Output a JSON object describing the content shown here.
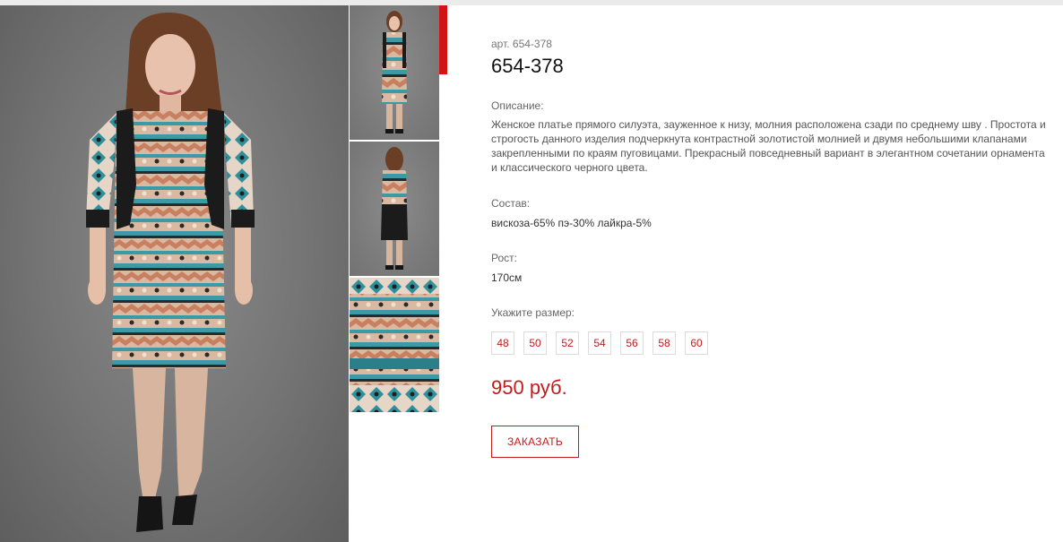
{
  "product": {
    "sku_line": "арт. 654-378",
    "title": "654-378",
    "description_label": "Описание:",
    "description": "Женское платье прямого силуэта, зауженное к низу, молния  расположена сзади  по среднему шву  . Простота и строгость данного изделия подчеркнута контрастной золотистой молнией и  двумя небольшими клапанами закрепленными по краям пуговицами. Прекрасный повседневный  вариант  в элегантном сочетании орнамента и классического черного цвета.",
    "composition_label": "Состав:",
    "composition": "вискоза-65% пэ-30% лайкра-5%",
    "height_label": "Рост:",
    "height": "170см",
    "size_label": "Укажите размер:",
    "sizes": [
      "48",
      "50",
      "52",
      "54",
      "56",
      "58",
      "60"
    ],
    "price": "950 руб.",
    "order_button": "ЗАКАЗАТЬ"
  },
  "gallery": {
    "thumbnails": [
      "front-view",
      "back-view",
      "fabric-pattern"
    ],
    "active_thumbnail": 0
  },
  "colors": {
    "accent": "#c41a1a",
    "marker": "#d11515",
    "photo_background": "#787878",
    "dress_teal": "#3a9aa6",
    "dress_beige": "#d6b8a4",
    "dress_black": "#1b1b1b"
  }
}
